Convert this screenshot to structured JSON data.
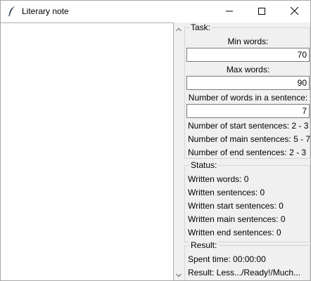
{
  "window": {
    "title": "Literary note",
    "app_icon": "feather-quill-icon"
  },
  "titlebar_buttons": {
    "minimize_icon": "minimize-icon",
    "maximize_icon": "maximize-icon",
    "close_icon": "close-icon"
  },
  "task": {
    "title": "Task:",
    "min_words_label": "Min words:",
    "min_words_value": "70",
    "max_words_label": "Max words:",
    "max_words_value": "90",
    "words_in_sentence_label": "Number of words in a sentence:",
    "words_in_sentence_value": "7",
    "start_sentences": "Number of start sentences: 2 - 3",
    "main_sentences": "Number of main sentences: 5 - 7",
    "end_sentences": "Number of end sentences: 2 - 3"
  },
  "status": {
    "title": "Status:",
    "written_words": "Written words: 0",
    "written_sentences": "Written sentences: 0",
    "written_start_sentences": "Written start sentences: 0",
    "written_main_sentences": "Written main sentences: 0",
    "written_end_sentences": "Written end sentences: 0"
  },
  "result": {
    "title": "Result:",
    "spent_time": "Spent time: 00:00:00",
    "result_text": "Result: Less.../Ready!/Much..."
  }
}
